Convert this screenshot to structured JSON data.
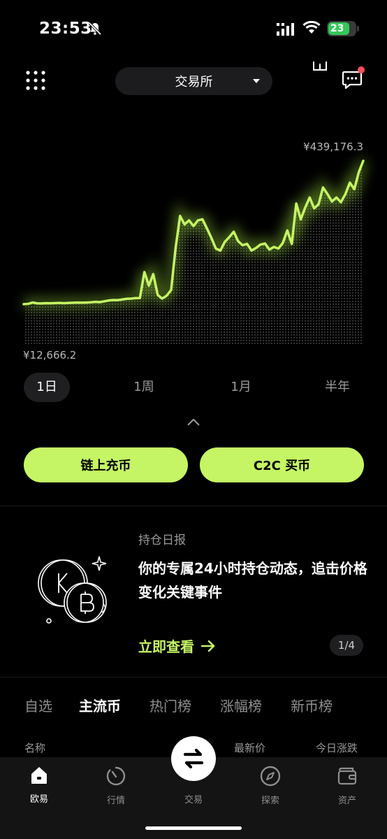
{
  "status_bar": {
    "time": "23:53",
    "battery": "23"
  },
  "header": {
    "exchange_label": "交易所"
  },
  "chart_data": {
    "type": "line",
    "max_label": "¥439,176.3",
    "min_label": "¥12,666.2",
    "y": [
      12666,
      13500,
      17500,
      15000,
      14800,
      15500,
      15200,
      15800,
      16200,
      15600,
      16500,
      16800,
      17200,
      17000,
      17500,
      18000,
      19500,
      18800,
      21000,
      23500,
      25000,
      24500,
      26500,
      28500,
      29000,
      30500,
      31000,
      108000,
      68000,
      102000,
      40000,
      29000,
      38000,
      55000,
      180000,
      275000,
      250000,
      262000,
      245000,
      262000,
      265000,
      238000,
      210000,
      178000,
      172000,
      198000,
      212000,
      228000,
      200000,
      188000,
      192000,
      172000,
      180000,
      190000,
      193000,
      175000,
      183000,
      178000,
      195000,
      232000,
      192000,
      312000,
      265000,
      300000,
      330000,
      298000,
      310000,
      360000,
      340000,
      318000,
      330000,
      316000,
      340000,
      374000,
      355000,
      405000,
      439176
    ],
    "ylim": [
      12666.2,
      439176.3
    ]
  },
  "periods": [
    "1日",
    "1周",
    "1月",
    "半年"
  ],
  "actions": {
    "onchain_deposit": "链上充币",
    "c2c_buy": "C2C 买币"
  },
  "report": {
    "title": "持仓日报",
    "body": "你的专属24小时持仓动态，追击价格变化关键事件",
    "link": "立即查看",
    "pager": "1/4"
  },
  "market_tabs": [
    "自选",
    "主流币",
    "热门榜",
    "涨幅榜",
    "新币榜"
  ],
  "columns": {
    "name": "名称",
    "last_price": "最新价",
    "change": "今日涨跌"
  },
  "nav": {
    "home": "欧易",
    "market": "行情",
    "trade": "交易",
    "explore": "探索",
    "assets": "资产"
  },
  "colors": {
    "accent": "#c5f564",
    "background": "#000000"
  }
}
